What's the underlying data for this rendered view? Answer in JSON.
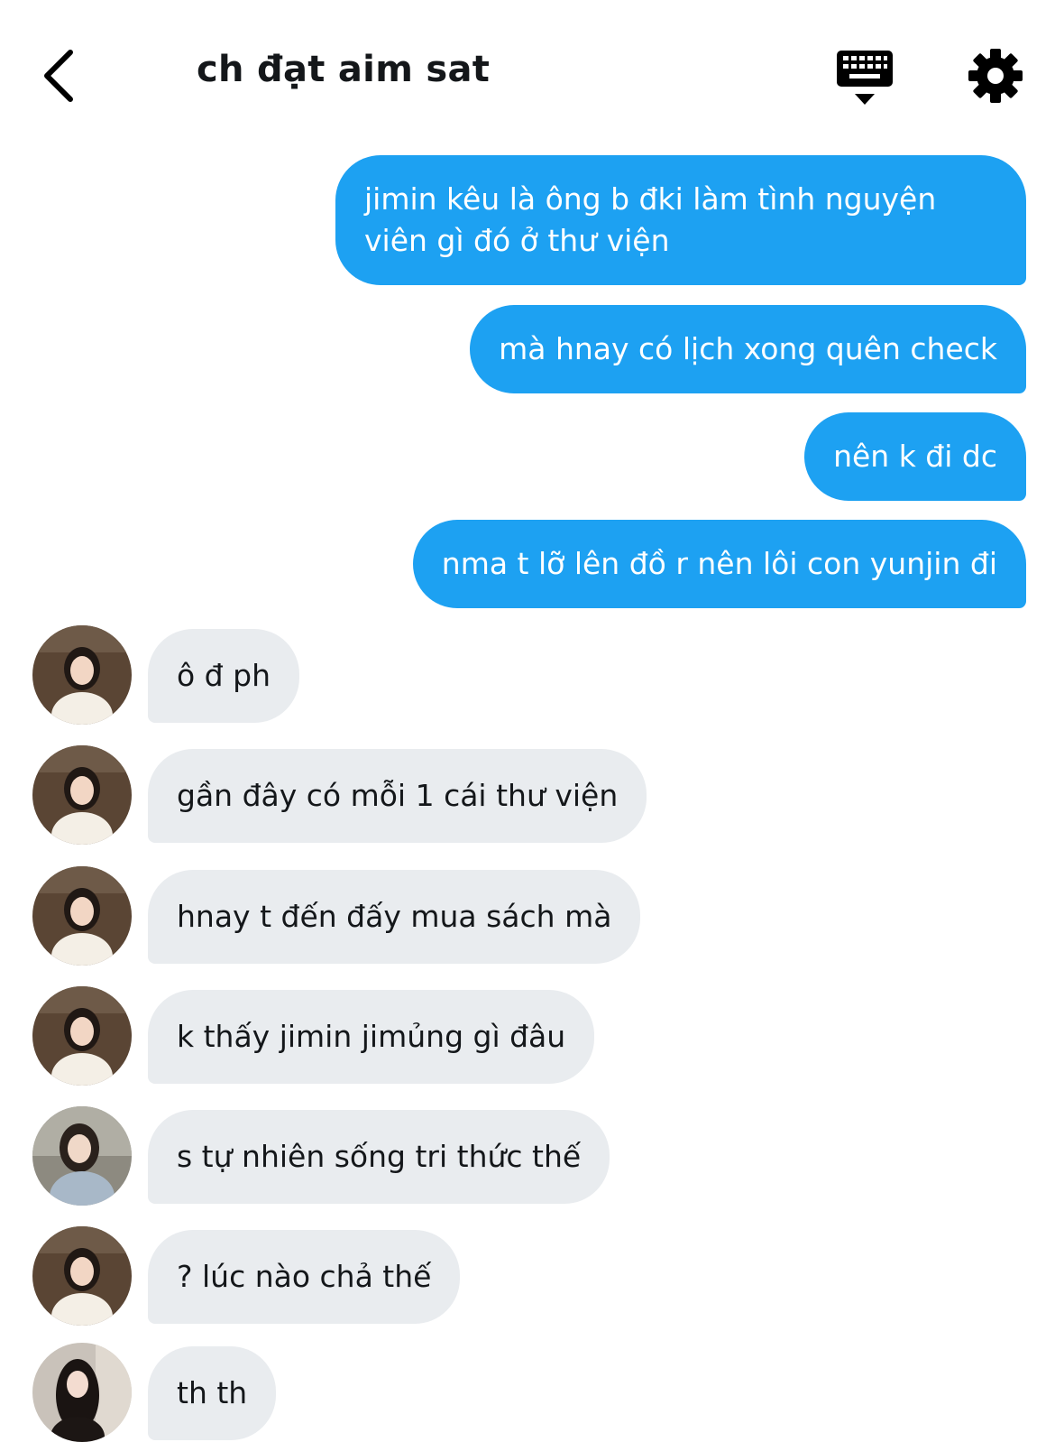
{
  "header": {
    "title": "ch đạt aim sat"
  },
  "colors": {
    "outgoing_bubble": "#1da1f2",
    "incoming_bubble": "#e9ecef",
    "text": "#14171a"
  },
  "messages": [
    {
      "direction": "outgoing",
      "text": "jimin kêu là ông b đki làm tình nguyện viên gì đó ở thư viện"
    },
    {
      "direction": "outgoing",
      "text": "mà hnay có lịch xong quên check"
    },
    {
      "direction": "outgoing",
      "text": "nên k đi dc"
    },
    {
      "direction": "outgoing",
      "text": "nma t lỡ lên đồ r nên lôi con yunjin đi"
    },
    {
      "direction": "incoming",
      "avatar": "avatar-a",
      "text": "ô đ ph"
    },
    {
      "direction": "incoming",
      "avatar": "avatar-a",
      "text": "gần đây có mỗi 1 cái thư viện"
    },
    {
      "direction": "incoming",
      "avatar": "avatar-a",
      "text": "hnay t đến đấy mua sách mà"
    },
    {
      "direction": "incoming",
      "avatar": "avatar-a",
      "text": "k thấy jimin jimủng gì đâu"
    },
    {
      "direction": "incoming",
      "avatar": "avatar-b",
      "text": "s tự nhiên sống tri thức thế"
    },
    {
      "direction": "incoming",
      "avatar": "avatar-a",
      "text": "? lúc nào chả thế"
    },
    {
      "direction": "incoming",
      "avatar": "avatar-c",
      "text": "th th"
    }
  ]
}
